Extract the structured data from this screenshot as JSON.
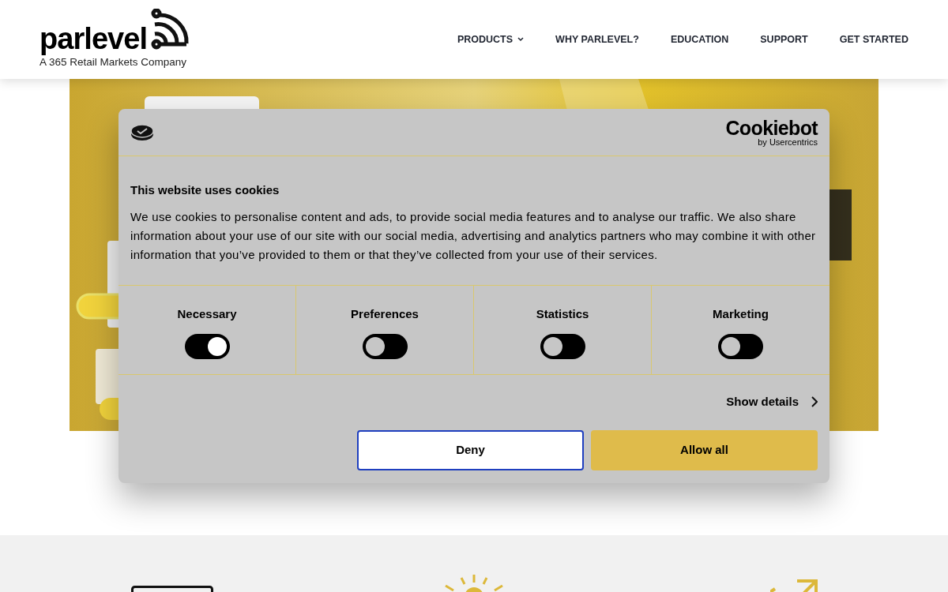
{
  "header": {
    "logo": {
      "wordmark": "parlevel",
      "tagline": "A 365 Retail Markets Company"
    },
    "nav": [
      {
        "label": "PRODUCTS",
        "has_menu": true
      },
      {
        "label": "WHY PARLEVEL?",
        "has_menu": false
      },
      {
        "label": "EDUCATION",
        "has_menu": false
      },
      {
        "label": "SUPPORT",
        "has_menu": false
      },
      {
        "label": "GET STARTED",
        "has_menu": false
      }
    ]
  },
  "cookie_dialog": {
    "brand": "Cookiebot",
    "brand_sub": "by Usercentrics",
    "title": "This website uses cookies",
    "body": "We use cookies to personalise content and ads, to provide social media features and to analyse our traffic. We also share information about your use of our site with our social media, advertising and analytics partners who may combine it with other information that you’ve provided to them or that they’ve collected from your use of their services.",
    "categories": [
      {
        "label": "Necessary",
        "on": true
      },
      {
        "label": "Preferences",
        "on": false
      },
      {
        "label": "Statistics",
        "on": false
      },
      {
        "label": "Marketing",
        "on": false
      }
    ],
    "details_link": "Show details",
    "buttons": [
      {
        "label": "Deny",
        "kind": "outline"
      },
      {
        "label": "Allow all",
        "kind": "primary"
      }
    ]
  }
}
